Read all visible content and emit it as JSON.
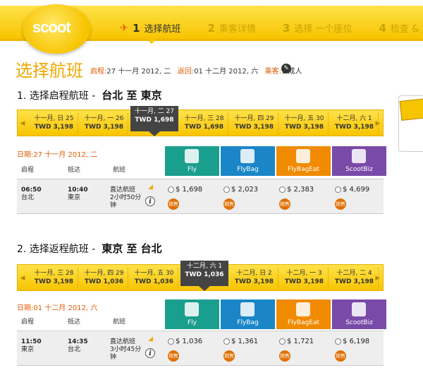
{
  "header": {
    "logo_text": "scoot",
    "steps": [
      {
        "num": "1",
        "label": "选择航班"
      },
      {
        "num": "2",
        "label": "乘客详情"
      },
      {
        "num": "3",
        "label": "选择 一个座位"
      },
      {
        "num": "4",
        "label": "检查 & 支"
      }
    ]
  },
  "page_title": "选择航班",
  "summary": {
    "depart_label": "启程:",
    "depart_value": "27 十一月 2012, 二",
    "return_label": "返回:",
    "return_value": "01 十二月 2012, 六",
    "pax_label": "乘客:",
    "pax_value": "1 成人"
  },
  "outbound": {
    "title_prefix": "1. 选择启程航班 -",
    "route": "台北  至  東京",
    "dates": [
      {
        "d": "十一月, 日 25",
        "p": "TWD 3,198"
      },
      {
        "d": "十一月, 一 26",
        "p": "TWD 3,198"
      },
      {
        "d": "十一月, 二 27",
        "p": "TWD 1,698"
      },
      {
        "d": "十一月, 三 28",
        "p": "TWD 1,698"
      },
      {
        "d": "十一月, 四 29",
        "p": "TWD 3,198"
      },
      {
        "d": "十一月, 五 30",
        "p": "TWD 3,198"
      },
      {
        "d": "十二月, 六 1",
        "p": "TWD 3,198"
      }
    ],
    "selected_index": 2,
    "date_row": "日期:27 十一月 2012, 二",
    "flight": {
      "dep_time": "06:50",
      "dep_city": "台北",
      "arr_time": "10:40",
      "arr_city": "東京",
      "type": "直达航班",
      "duration": "2小时50分",
      "prices": [
        "$ 1,698",
        "$ 2,023",
        "$ 2,383",
        "$ 4,699"
      ]
    }
  },
  "inbound": {
    "title_prefix": "2. 选择返程航班 -",
    "route": "東京  至  台北",
    "dates": [
      {
        "d": "十一月, 三 28",
        "p": "TWD 3,198"
      },
      {
        "d": "十一月, 四 29",
        "p": "TWD 1,036"
      },
      {
        "d": "十一月, 五 30",
        "p": "TWD 1,036"
      },
      {
        "d": "十二月, 六 1",
        "p": "TWD 1,036"
      },
      {
        "d": "十二月, 日 2",
        "p": "TWD 3,198"
      },
      {
        "d": "十二月, 一 3",
        "p": "TWD 3,198"
      },
      {
        "d": "十二月, 二 4",
        "p": "TWD 3,198"
      }
    ],
    "selected_index": 3,
    "date_row": "日期:01 十二月 2012, 六",
    "flight": {
      "dep_time": "11:50",
      "dep_city": "東京",
      "arr_time": "14:35",
      "arr_city": "台北",
      "type": "直达航班",
      "duration": "3小时45分",
      "duration_tail": "钟",
      "prices": [
        "$ 1,036",
        "$ 1,361",
        "$ 1,721",
        "$ 6,198"
      ]
    }
  },
  "columns": {
    "depart": "启程",
    "arrive": "抵达",
    "flight": "航班"
  },
  "fares": [
    {
      "name": "Fly",
      "color": "#1a9e8e"
    },
    {
      "name": "FlyBag",
      "color": "#1a86c8"
    },
    {
      "name": "FlyBagEat",
      "color": "#f08a00"
    },
    {
      "name": "ScootBiz",
      "color": "#7a4aa8"
    }
  ],
  "badge_text": "销售",
  "outbound_duration_tail": "钟",
  "icons": {
    "edit": "edit-icon",
    "info": "info-icon",
    "plane": "plane-icon"
  }
}
